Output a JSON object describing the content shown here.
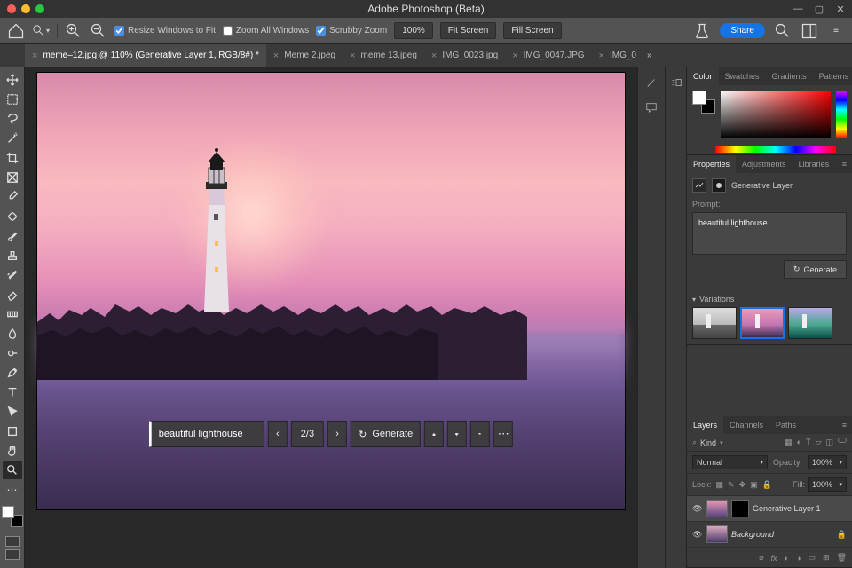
{
  "app_title": "Adobe Photoshop (Beta)",
  "options": {
    "resize_label": "Resize Windows to Fit",
    "zoom_all_label": "Zoom All Windows",
    "scrubby_label": "Scrubby Zoom",
    "zoom_level": "100%",
    "fit_screen": "Fit Screen",
    "fill_screen": "Fill Screen",
    "share": "Share"
  },
  "tabs": [
    {
      "label": "meme–12.jpg @ 110% (Generative Layer 1, RGB/8#) *",
      "active": true
    },
    {
      "label": "Meme 2.jpeg",
      "active": false
    },
    {
      "label": "meme 13.jpeg",
      "active": false
    },
    {
      "label": "IMG_0023.jpg",
      "active": false
    },
    {
      "label": "IMG_0047.JPG",
      "active": false
    },
    {
      "label": "IMG_0",
      "active": false
    }
  ],
  "overflow_glyph": "»",
  "genbar": {
    "prompt": "beautiful lighthouse",
    "counter": "2/3",
    "generate": "Generate"
  },
  "right_tabs": {
    "color": [
      "Color",
      "Swatches",
      "Gradients",
      "Patterns"
    ],
    "props": [
      "Properties",
      "Adjustments",
      "Libraries"
    ],
    "layers": [
      "Layers",
      "Channels",
      "Paths"
    ]
  },
  "properties": {
    "title": "Generative Layer",
    "prompt_label": "Prompt:",
    "prompt_value": "beautiful lighthouse",
    "generate": "Generate",
    "variations_label": "Variations"
  },
  "layers": {
    "kind": "Kind",
    "blend": "Normal",
    "opacity_label": "Opacity:",
    "opacity": "100%",
    "lock_label": "Lock:",
    "fill_label": "Fill:",
    "fill": "100%",
    "items": [
      {
        "name": "Generative Layer 1",
        "bg": false,
        "selected": true
      },
      {
        "name": "Background",
        "bg": true,
        "selected": false
      }
    ]
  },
  "colors": {
    "accent": "#1473e6"
  }
}
